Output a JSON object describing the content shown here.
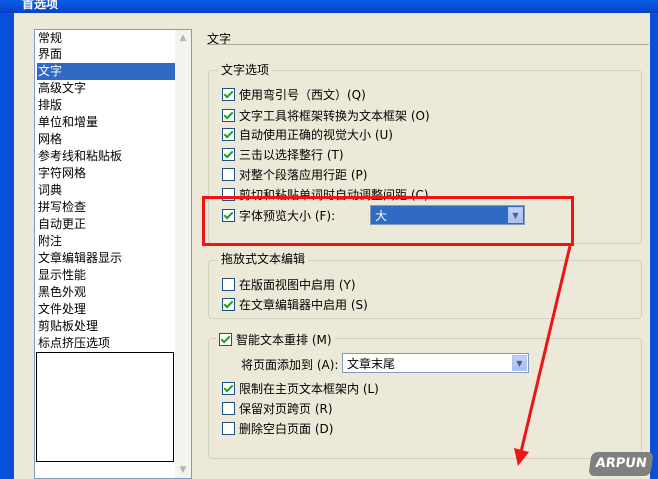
{
  "window": {
    "title": "首选项"
  },
  "categories": {
    "items": [
      "常规",
      "界面",
      "文字",
      "高级文字",
      "排版",
      "单位和增量",
      "网格",
      "参考线和粘贴板",
      "字符网格",
      "词典",
      "拼写检查",
      "自动更正",
      "附注",
      "文章编辑器显示",
      "显示性能",
      "黑色外观",
      "文件处理",
      "剪贴板处理",
      "标点挤压选项"
    ],
    "selected": "文字"
  },
  "panel": {
    "title": "文字"
  },
  "text_options": {
    "legend": "文字选项",
    "items": [
      {
        "label": "使用弯引号（西文）(Q)",
        "checked": true
      },
      {
        "label": "文字工具将框架转换为文本框架 (O)",
        "checked": true
      },
      {
        "label": "自动使用正确的视觉大小 (U)",
        "checked": true
      },
      {
        "label": "三击以选择整行 (T)",
        "checked": true
      },
      {
        "label": "对整个段落应用行距 (P)",
        "checked": false
      },
      {
        "label": "剪切和粘贴单词时自动调整间距 (C)",
        "checked": false
      }
    ],
    "preview": {
      "label": "字体预览大小 (F):",
      "checked": true,
      "value": "大"
    }
  },
  "drag_edit": {
    "legend": "拖放式文本编辑",
    "items": [
      {
        "label": "在版面视图中启用 (Y)",
        "checked": false
      },
      {
        "label": "在文章编辑器中启用 (S)",
        "checked": true
      }
    ]
  },
  "smart_reflow": {
    "legend": "智能文本重排 (M)",
    "checked": true,
    "add_pages": {
      "label": "将页面添加到 (A):",
      "value": "文章末尾"
    },
    "items": [
      {
        "label": "限制在主页文本框架内 (L)",
        "checked": true
      },
      {
        "label": "保留对页跨页 (R)",
        "checked": false
      },
      {
        "label": "删除空白页面 (D)",
        "checked": false
      }
    ]
  },
  "watermark": "ARPUN",
  "colors": {
    "selection": "#316ac5",
    "annotation": "#f01414"
  }
}
